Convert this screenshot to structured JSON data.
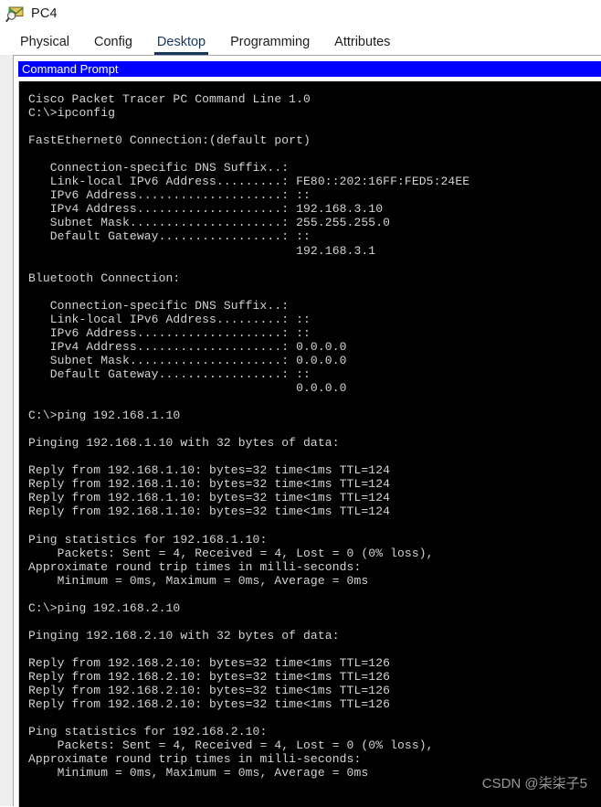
{
  "window": {
    "title": "PC4",
    "icon": "packet-tracer-envelope-magnifier-icon"
  },
  "tabs": [
    {
      "label": "Physical",
      "selected": false
    },
    {
      "label": "Config",
      "selected": false
    },
    {
      "label": "Desktop",
      "selected": true
    },
    {
      "label": "Programming",
      "selected": false
    },
    {
      "label": "Attributes",
      "selected": false
    }
  ],
  "command_prompt": {
    "title": "Command Prompt",
    "titlebar_color": "#0000FF",
    "background_color": "#000000",
    "text_color": "#D4D4D4",
    "banner": "Cisco Packet Tracer PC Command Line 1.0",
    "commands": [
      {
        "prompt": "C:\\>",
        "command": "ipconfig"
      },
      {
        "prompt": "C:\\>",
        "command": "ping 192.168.1.10"
      },
      {
        "prompt": "C:\\>",
        "command": "ping 192.168.2.10"
      }
    ],
    "ipconfig": {
      "interfaces": [
        {
          "name": "FastEthernet0 Connection:(default port)",
          "fields": [
            {
              "label": "Connection-specific DNS Suffix..",
              "value": ""
            },
            {
              "label": "Link-local IPv6 Address.........",
              "value": "FE80::202:16FF:FED5:24EE"
            },
            {
              "label": "IPv6 Address....................",
              "value": "::"
            },
            {
              "label": "IPv4 Address....................",
              "value": "192.168.3.10"
            },
            {
              "label": "Subnet Mask.....................",
              "value": "255.255.255.0"
            },
            {
              "label": "Default Gateway.................",
              "value": "::"
            }
          ],
          "gateway_extra": "192.168.3.1"
        },
        {
          "name": "Bluetooth Connection:",
          "fields": [
            {
              "label": "Connection-specific DNS Suffix..",
              "value": ""
            },
            {
              "label": "Link-local IPv6 Address.........",
              "value": "::"
            },
            {
              "label": "IPv6 Address....................",
              "value": "::"
            },
            {
              "label": "IPv4 Address....................",
              "value": "0.0.0.0"
            },
            {
              "label": "Subnet Mask.....................",
              "value": "0.0.0.0"
            },
            {
              "label": "Default Gateway.................",
              "value": "::"
            }
          ],
          "gateway_extra": "0.0.0.0"
        }
      ]
    },
    "pings": [
      {
        "target": "192.168.1.10",
        "header": "Pinging 192.168.1.10 with 32 bytes of data:",
        "replies": [
          "Reply from 192.168.1.10: bytes=32 time<1ms TTL=124",
          "Reply from 192.168.1.10: bytes=32 time<1ms TTL=124",
          "Reply from 192.168.1.10: bytes=32 time<1ms TTL=124",
          "Reply from 192.168.1.10: bytes=32 time<1ms TTL=124"
        ],
        "stats_title": "Ping statistics for 192.168.1.10:",
        "packets": "    Packets: Sent = 4, Received = 4, Lost = 0 (0% loss),",
        "rtt_title": "Approximate round trip times in milli-seconds:",
        "rtt": "    Minimum = 0ms, Maximum = 0ms, Average = 0ms"
      },
      {
        "target": "192.168.2.10",
        "header": "Pinging 192.168.2.10 with 32 bytes of data:",
        "replies": [
          "Reply from 192.168.2.10: bytes=32 time<1ms TTL=126",
          "Reply from 192.168.2.10: bytes=32 time<1ms TTL=126",
          "Reply from 192.168.2.10: bytes=32 time<1ms TTL=126",
          "Reply from 192.168.2.10: bytes=32 time<1ms TTL=126"
        ],
        "stats_title": "Ping statistics for 192.168.2.10:",
        "packets": "    Packets: Sent = 4, Received = 4, Lost = 0 (0% loss),",
        "rtt_title": "Approximate round trip times in milli-seconds:",
        "rtt": "    Minimum = 0ms, Maximum = 0ms, Average = 0ms"
      }
    ],
    "terminal_text": "Cisco Packet Tracer PC Command Line 1.0\nC:\\>ipconfig\n\nFastEthernet0 Connection:(default port)\n\n   Connection-specific DNS Suffix..:\n   Link-local IPv6 Address.........: FE80::202:16FF:FED5:24EE\n   IPv6 Address....................: ::\n   IPv4 Address....................: 192.168.3.10\n   Subnet Mask.....................: 255.255.255.0\n   Default Gateway.................: ::\n                                     192.168.3.1\n\nBluetooth Connection:\n\n   Connection-specific DNS Suffix..:\n   Link-local IPv6 Address.........: ::\n   IPv6 Address....................: ::\n   IPv4 Address....................: 0.0.0.0\n   Subnet Mask.....................: 0.0.0.0\n   Default Gateway.................: ::\n                                     0.0.0.0\n\nC:\\>ping 192.168.1.10\n\nPinging 192.168.1.10 with 32 bytes of data:\n\nReply from 192.168.1.10: bytes=32 time<1ms TTL=124\nReply from 192.168.1.10: bytes=32 time<1ms TTL=124\nReply from 192.168.1.10: bytes=32 time<1ms TTL=124\nReply from 192.168.1.10: bytes=32 time<1ms TTL=124\n\nPing statistics for 192.168.1.10:\n    Packets: Sent = 4, Received = 4, Lost = 0 (0% loss),\nApproximate round trip times in milli-seconds:\n    Minimum = 0ms, Maximum = 0ms, Average = 0ms\n\nC:\\>ping 192.168.2.10\n\nPinging 192.168.2.10 with 32 bytes of data:\n\nReply from 192.168.2.10: bytes=32 time<1ms TTL=126\nReply from 192.168.2.10: bytes=32 time<1ms TTL=126\nReply from 192.168.2.10: bytes=32 time<1ms TTL=126\nReply from 192.168.2.10: bytes=32 time<1ms TTL=126\n\nPing statistics for 192.168.2.10:\n    Packets: Sent = 4, Received = 4, Lost = 0 (0% loss),\nApproximate round trip times in milli-seconds:\n    Minimum = 0ms, Maximum = 0ms, Average = 0ms"
  },
  "watermark": {
    "text": "CSDN @柒柒子5"
  }
}
